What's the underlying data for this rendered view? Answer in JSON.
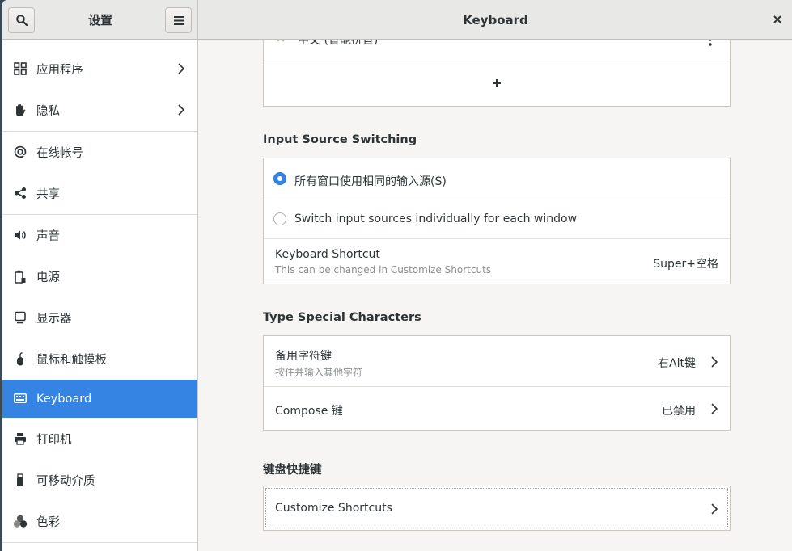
{
  "header": {
    "sidebar_title": "设置",
    "main_title": "Keyboard",
    "search_icon": "search-icon",
    "menu_icon": "hamburger-menu-icon",
    "close_icon": "close-icon"
  },
  "sidebar": {
    "items": [
      {
        "label": "应用程序",
        "icon": "grid-icon",
        "has_chevron": true
      },
      {
        "label": "隐私",
        "icon": "hand-icon",
        "has_chevron": true
      },
      {
        "label": "在线帐号",
        "icon": "at-icon",
        "has_chevron": false
      },
      {
        "label": "共享",
        "icon": "share-icon",
        "has_chevron": false
      },
      {
        "label": "声音",
        "icon": "speaker-icon",
        "has_chevron": false
      },
      {
        "label": "电源",
        "icon": "battery-icon",
        "has_chevron": false
      },
      {
        "label": "显示器",
        "icon": "display-icon",
        "has_chevron": false
      },
      {
        "label": "鼠标和触摸板",
        "icon": "mouse-icon",
        "has_chevron": false
      },
      {
        "label": "Keyboard",
        "icon": "keyboard-icon",
        "has_chevron": false,
        "active": true
      },
      {
        "label": "打印机",
        "icon": "printer-icon",
        "has_chevron": false
      },
      {
        "label": "可移动介质",
        "icon": "usb-icon",
        "has_chevron": false
      },
      {
        "label": "色彩",
        "icon": "color-icon",
        "has_chevron": false
      }
    ],
    "active_color": "#3584e4"
  },
  "input_sources": {
    "partial_source_label": "中文 (智能拼音)",
    "add_icon": "plus-icon"
  },
  "switching": {
    "title": "Input Source Switching",
    "option_same": "所有窗口使用相同的输入源(S)",
    "option_individual": "Switch input sources individually for each window",
    "selected": "option_same",
    "shortcut_title": "Keyboard Shortcut",
    "shortcut_subtitle": "This can be changed in Customize Shortcuts",
    "shortcut_value": "Super+空格"
  },
  "special_chars": {
    "title": "Type Special Characters",
    "alternate_title": "备用字符键",
    "alternate_subtitle": "按住并输入其他字符",
    "alternate_value": "右Alt键",
    "compose_title": "Compose 键",
    "compose_value": "已禁用"
  },
  "shortcuts": {
    "title": "键盘快捷键",
    "customize_label": "Customize Shortcuts"
  }
}
